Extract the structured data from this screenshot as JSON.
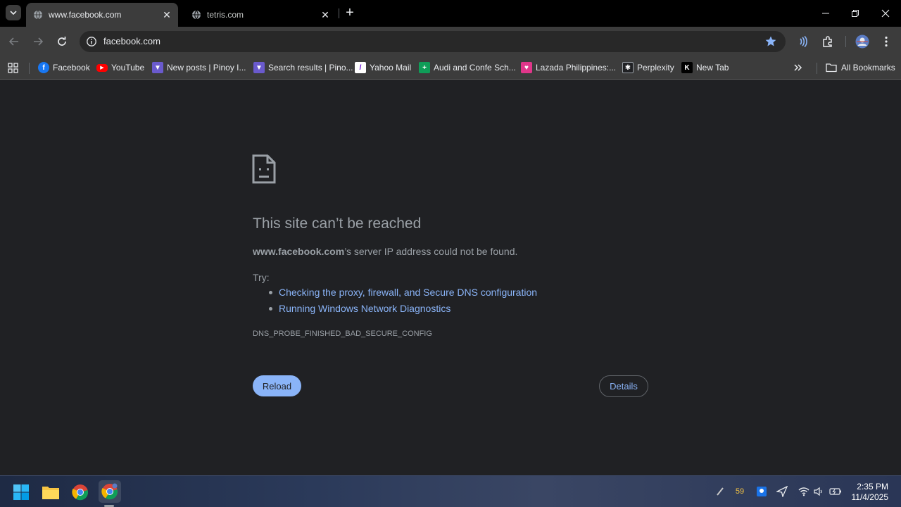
{
  "tabs": [
    {
      "title": "www.facebook.com",
      "active": true
    },
    {
      "title": "tetris.com",
      "active": false
    }
  ],
  "omnibox": {
    "url": "facebook.com"
  },
  "bookmarks": [
    {
      "label": "Facebook",
      "icon": "facebook-icon",
      "color": "#1877f2"
    },
    {
      "label": "YouTube",
      "icon": "youtube-icon",
      "color": "#ff0000"
    },
    {
      "label": "New posts | Pinoy I...",
      "icon": "pinoy-forum-icon",
      "color": "#6a5acd"
    },
    {
      "label": "Search results | Pino...",
      "icon": "pinoy-forum-icon",
      "color": "#6a5acd"
    },
    {
      "label": "Yahoo Mail",
      "icon": "yahoo-icon",
      "color": "#ffffff"
    },
    {
      "label": "Audi and Confe Sch...",
      "icon": "sheets-icon",
      "color": "#0f9d58"
    },
    {
      "label": "Lazada Philippines:...",
      "icon": "lazada-icon",
      "color": "#e0368a"
    },
    {
      "label": "Perplexity",
      "icon": "perplexity-icon",
      "color": "#202124"
    },
    {
      "label": "New Tab",
      "icon": "new-tab-k-icon",
      "color": "#000000"
    }
  ],
  "all_bookmarks_label": "All Bookmarks",
  "error": {
    "title": "This site can’t be reached",
    "host": "www.facebook.com",
    "desc_rest": "’s server IP address could not be found.",
    "try_label": "Try:",
    "suggestions": [
      "Checking the proxy, firewall, and Secure DNS configuration",
      "Running Windows Network Diagnostics"
    ],
    "code": "DNS_PROBE_FINISHED_BAD_SECURE_CONFIG",
    "reload_label": "Reload",
    "details_label": "Details"
  },
  "taskbar": {
    "tray_count": "59",
    "time": "2:35 PM",
    "date": "11/4/2025"
  },
  "colors": {
    "accent": "#8ab4f8",
    "page_bg": "#202124",
    "toolbar_bg": "#3c3c3c"
  }
}
